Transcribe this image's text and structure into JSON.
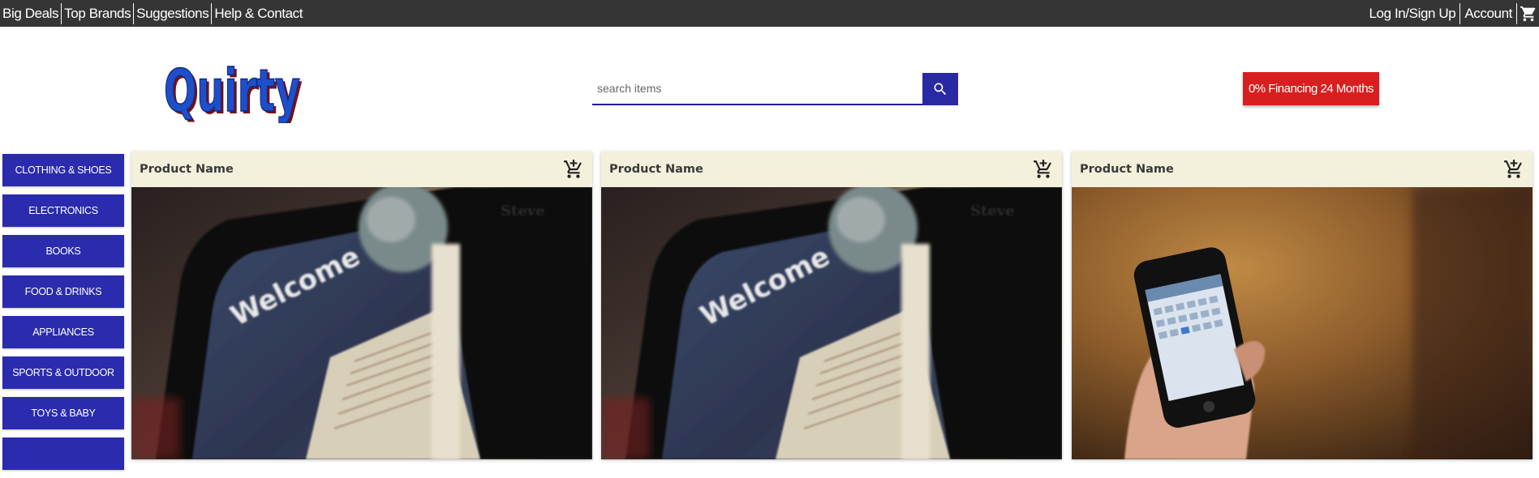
{
  "topbar": {
    "left_links": [
      "Big Deals",
      "Top Brands",
      "Suggestions",
      "Help & Contact"
    ],
    "right_links": [
      "Log In/Sign Up",
      "Account"
    ],
    "cart_icon": "cart-icon"
  },
  "header": {
    "logo_text": "Quirty",
    "search": {
      "placeholder": "search items",
      "value": "",
      "button_icon": "search-icon"
    },
    "promo_label": "0% Financing 24 Months"
  },
  "colors": {
    "topbar_bg": "#353535",
    "accent_blue": "#2b2bad",
    "promo_red": "#d81f1f",
    "card_header_bg": "#f3f1dc"
  },
  "sidebar": {
    "categories": [
      "CLOTHING & SHOES",
      "ELECTRONICS",
      "BOOKS",
      "FOOD & DRINKS",
      "APPLIANCES",
      "SPORTS & OUTDOOR",
      "TOYS & BABY"
    ]
  },
  "products": [
    {
      "name": "Product Name",
      "image": "tablet-on-bookshelf-photo",
      "cart_icon": "add-to-cart-icon"
    },
    {
      "name": "Product Name",
      "image": "tablet-on-bookshelf-photo",
      "cart_icon": "add-to-cart-icon"
    },
    {
      "name": "Product Name",
      "image": "hand-holding-smartphone-photo",
      "cart_icon": "add-to-cart-icon"
    }
  ]
}
